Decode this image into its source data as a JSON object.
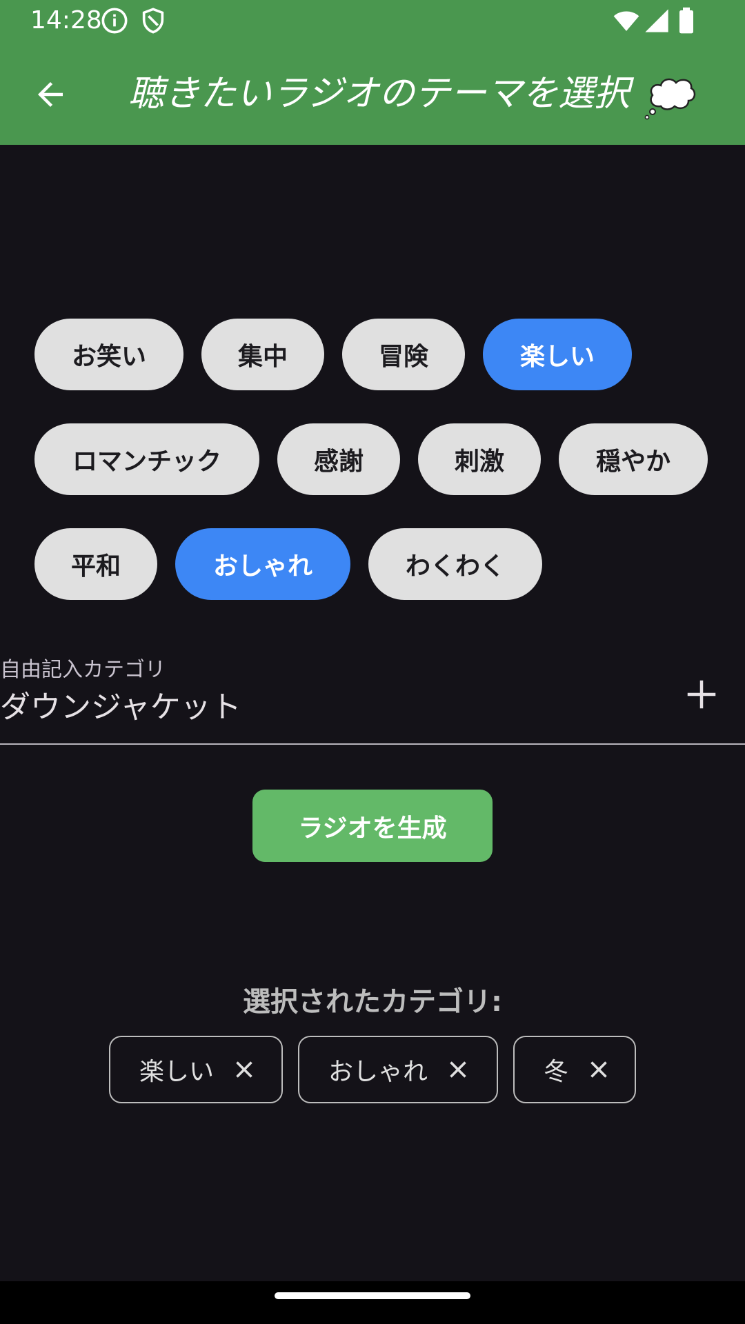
{
  "status_bar": {
    "time": "14:28",
    "icons": [
      "info-icon",
      "shield-icon",
      "wifi-icon",
      "signal-icon",
      "battery-icon"
    ]
  },
  "app_bar": {
    "title": "聴きたいラジオのテーマを選択",
    "back_icon": "arrow-back-icon",
    "decoration_icon": "thought-bubble-icon",
    "background_color": "#4a974f"
  },
  "theme_chips": {
    "rows": [
      [
        {
          "label": "お笑い",
          "selected": false
        },
        {
          "label": "集中",
          "selected": false
        },
        {
          "label": "冒険",
          "selected": false
        },
        {
          "label": "楽しい",
          "selected": true
        }
      ],
      [
        {
          "label": "ロマンチック",
          "selected": false
        },
        {
          "label": "感謝",
          "selected": false
        },
        {
          "label": "刺激",
          "selected": false
        },
        {
          "label": "穏やか",
          "selected": false
        }
      ],
      [
        {
          "label": "平和",
          "selected": false
        },
        {
          "label": "おしゃれ",
          "selected": true
        },
        {
          "label": "わくわく",
          "selected": false
        }
      ]
    ],
    "selected_color": "#3d87f5",
    "unselected_color": "#e0e0e0"
  },
  "custom_category": {
    "label": "自由記入カテゴリ",
    "value": "ダウンジャケット",
    "add_icon": "plus-icon"
  },
  "generate_button": {
    "label": "ラジオを生成",
    "color": "#63b968"
  },
  "selected_categories": {
    "title": "選択されたカテゴリ:",
    "items": [
      "楽しい",
      "おしゃれ",
      "冬"
    ],
    "remove_icon": "close-icon"
  }
}
